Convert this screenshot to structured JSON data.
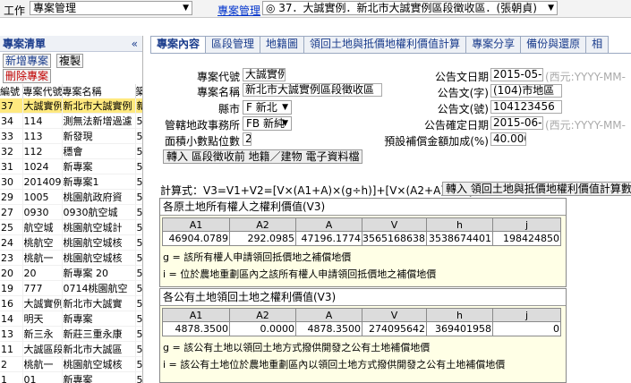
{
  "topbar": {
    "work_label": "工作",
    "work_select": "專案管理",
    "case_link": "專案管理",
    "case_select": "◎ 37．大誠實例．新北市大誠實例區段徵收區．(張朝貞)"
  },
  "left": {
    "title": "專案清單",
    "collapse": "«",
    "new_btn": "新增專案",
    "copy_btn": "複製",
    "delete_btn": "刪除專案",
    "columns": [
      "編號",
      "專案代號",
      "專案名稱",
      "築"
    ],
    "rows": [
      [
        "37",
        "大誠實例",
        "新北市大誠實例",
        "新"
      ],
      [
        "34",
        "114",
        "測無法新增過濾",
        "5"
      ],
      [
        "33",
        "113",
        "新發現",
        "5"
      ],
      [
        "32",
        "112",
        "穩會",
        "5"
      ],
      [
        "31",
        "1024",
        "新專案",
        "5"
      ],
      [
        "30",
        "2014091",
        "新專案1",
        "5"
      ],
      [
        "29",
        "1005",
        "桃園航政府資",
        "5"
      ],
      [
        "27",
        "0930",
        "0930航空城",
        "5"
      ],
      [
        "25",
        "航空城",
        "桃園航空城計",
        "5"
      ],
      [
        "24",
        "桃航空",
        "桃園航空城核",
        "5"
      ],
      [
        "23",
        "桃航一",
        "桃園航空城核",
        "5"
      ],
      [
        "20",
        "20",
        "新專案 20",
        "5"
      ],
      [
        "19",
        "777",
        "0714桃園航空",
        "5"
      ],
      [
        "16",
        "大誠實例",
        "新北市大誠實",
        "5"
      ],
      [
        "14",
        "明天",
        "新專案",
        "5"
      ],
      [
        "13",
        "新三永",
        "新莊三重永康",
        "5"
      ],
      [
        "11",
        "大誠區段",
        "新北市大誠區",
        "5"
      ],
      [
        "2",
        "桃航一",
        "桃園航空城核",
        "5"
      ],
      [
        "1",
        "01",
        "新專案",
        "5"
      ]
    ]
  },
  "tabs": [
    "專案內容",
    "區段管理",
    "地籍圖",
    "領回土地與抵價地權利價值計算",
    "專案分享",
    "備份與還原",
    "相"
  ],
  "form": {
    "code_label": "專案代號",
    "code": "大誠實例",
    "name_label": "專案名稱",
    "name": "新北市大誠實例區段徵收區",
    "county_label": "縣市",
    "county": "F 新北",
    "office_label": "管轄地政事務所",
    "office": "FB 新純",
    "decimals_label": "面積小數點位數",
    "decimals": "2",
    "import_btn": "轉入 區段徵收前 地籍／建物 電子資料檔",
    "ann_date_label": "公告文日期",
    "ann_date": "2015-05-1",
    "date_hint": "(西元:YYYY-MM-",
    "ann_char_label": "公告文(字)",
    "ann_char": "(104)市地區",
    "ann_no_label": "公告文(號)",
    "ann_no": "104123456",
    "confirm_date_label": "公告確定日期",
    "confirm_date": "2015-06-1",
    "confirm_hint": "(西元:YYYY-MM-",
    "comp_label": "預設補償金額加成(%)",
    "comp": "40.000"
  },
  "formula": {
    "label": "計算式：V3=V1+V2=[V×(A1+A)×(g÷h)]+[V×(A2+A)×(i÷j)]",
    "import_btn": "轉入 領回土地與抵價地權利價值計算數"
  },
  "section1": {
    "title": "各原土地所有權人之權利價值(V3)",
    "headers": [
      "A1",
      "A2",
      "A",
      "V",
      "h",
      "j"
    ],
    "values": [
      "46904.0789",
      "292.0985",
      "47196.1774",
      "3565168638",
      "3538674401",
      "198424850"
    ],
    "note_g": "g = 該所有權人申請領回抵價地之補償地價",
    "note_i": "i = 位於農地重劃區內之該所有權人申請領回抵價地之補償地價"
  },
  "section2": {
    "title": "各公有土地領回土地之權利價值(V3)",
    "headers": [
      "A1",
      "A2",
      "A",
      "V",
      "h",
      "j"
    ],
    "values": [
      "4878.3500",
      "0.0000",
      "4878.3500",
      "274095642",
      "369401958",
      "0"
    ],
    "note_g": "g = 該公有土地以領回土地方式撥供開發之公有土地補償地價",
    "note_i": "i = 該公有土地位於農地重劃區內以領回土地方式撥供開發之公有土地補償地價"
  }
}
